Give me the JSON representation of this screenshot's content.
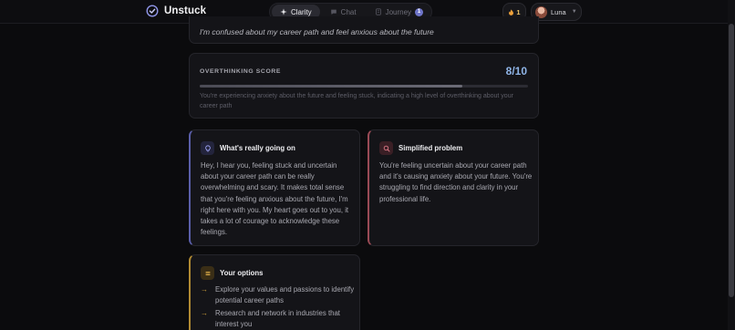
{
  "app": {
    "name": "Unstuck"
  },
  "nav": {
    "tabs": [
      {
        "label": "Clarity",
        "icon": "sparkle-icon",
        "active": true
      },
      {
        "label": "Chat",
        "icon": "chat-bubble-icon",
        "active": false
      },
      {
        "label": "Journey",
        "icon": "journal-icon",
        "active": false,
        "badge": "1"
      }
    ]
  },
  "streak": {
    "icon": "fire-icon",
    "count": "1"
  },
  "user": {
    "name": "Luna"
  },
  "query": {
    "text": "I'm confused about my career path and feel anxious about the future"
  },
  "score": {
    "label": "OVERTHINKING SCORE",
    "value": "8/10",
    "fraction": 0.8,
    "description": "You're experiencing anxiety about the future and feeling stuck, indicating a high level of overthinking about your career path"
  },
  "going_on": {
    "title": "What's really going on",
    "icon": "lightbulb-icon",
    "body": "Hey, I hear you, feeling stuck and uncertain about your career path can be really overwhelming and scary. It makes total sense that you're feeling anxious about the future, I'm right here with you. My heart goes out to you, it takes a lot of courage to acknowledge these feelings."
  },
  "simplified": {
    "title": "Simplified problem",
    "icon": "search-icon",
    "body": "You're feeling uncertain about your career path and it's causing anxiety about your future. You're struggling to find direction and clarity in your professional life."
  },
  "options": {
    "title": "Your options",
    "icon": "list-icon",
    "items": [
      "Explore your values and passions to identify potential career paths",
      "Research and network in industries that interest you"
    ]
  },
  "colors": {
    "background": "#0b0b0d",
    "accent_blue": "#5a5ea8",
    "accent_red": "#9a4a55",
    "accent_gold": "#b08a32",
    "score": "#8fb4e6"
  }
}
